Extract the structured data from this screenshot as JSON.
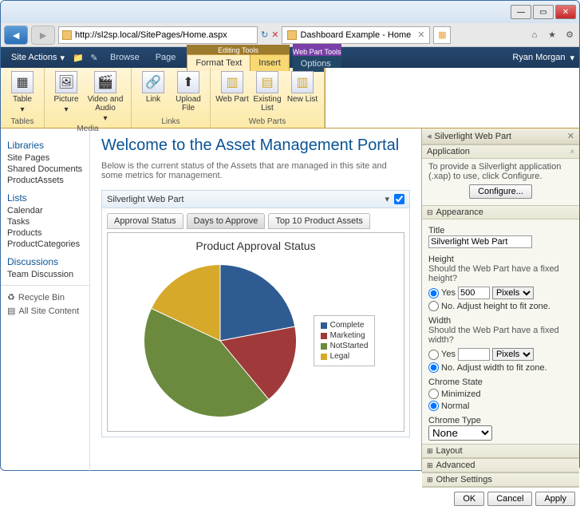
{
  "window": {
    "url": "http://sl2sp.local/SitePages/Home.aspx",
    "tab_title": "Dashboard Example - Home"
  },
  "sp": {
    "site_actions": "Site Actions",
    "browse": "Browse",
    "page": "Page",
    "editing_tools": "Editing Tools",
    "format_text": "Format Text",
    "insert": "Insert",
    "webpart_tools": "Web Part Tools",
    "options": "Options",
    "user": "Ryan Morgan"
  },
  "ribbon": {
    "table": "Table",
    "picture": "Picture",
    "video": "Video and Audio",
    "link": "Link",
    "upload": "Upload File",
    "webpart": "Web Part",
    "existing": "Existing List",
    "newlist": "New List",
    "g_tables": "Tables",
    "g_media": "Media",
    "g_links": "Links",
    "g_webparts": "Web Parts"
  },
  "nav": {
    "libraries": "Libraries",
    "site_pages": "Site Pages",
    "shared_docs": "Shared Documents",
    "product_assets": "ProductAssets",
    "lists": "Lists",
    "calendar": "Calendar",
    "tasks": "Tasks",
    "products": "Products",
    "product_cats": "ProductCategories",
    "discussions": "Discussions",
    "team_disc": "Team Discussion",
    "recycle": "Recycle Bin",
    "all_content": "All Site Content"
  },
  "main": {
    "title": "Welcome to the Asset Management Portal",
    "desc": "Below is the current status of the Assets that are managed in this site and some metrics for management.",
    "wp_title": "Silverlight Web Part",
    "tabs": [
      "Approval Status",
      "Days to Approve",
      "Top 10 Product Assets"
    ],
    "chart_title": "Product Approval Status"
  },
  "chart_data": {
    "type": "pie",
    "title": "Product Approval Status",
    "series": [
      {
        "name": "Complete",
        "value": 22,
        "color": "#2f5b93"
      },
      {
        "name": "Marketing",
        "value": 17,
        "color": "#a03a3a"
      },
      {
        "name": "NotStarted",
        "value": 43,
        "color": "#6b8a3e"
      },
      {
        "name": "Legal",
        "value": 18,
        "color": "#d6a92a"
      }
    ]
  },
  "props": {
    "title": "Silverlight Web Part",
    "sec_app": "Application",
    "app_hint": "To provide a Silverlight application (.xap) to use, click Configure.",
    "configure": "Configure...",
    "sec_appearance": "Appearance",
    "lbl_title": "Title",
    "val_title": "Silverlight Web Part",
    "lbl_height": "Height",
    "height_q": "Should the Web Part have a fixed height?",
    "yes": "Yes",
    "no_height": "No. Adjust height to fit zone.",
    "height_val": "500",
    "pixels": "Pixels",
    "lbl_width": "Width",
    "width_q": "Should the Web Part have a fixed width?",
    "no_width": "No. Adjust width to fit zone.",
    "lbl_chrome_state": "Chrome State",
    "minimized": "Minimized",
    "normal": "Normal",
    "lbl_chrome_type": "Chrome Type",
    "chrome_type": "None",
    "sec_layout": "Layout",
    "sec_advanced": "Advanced",
    "sec_other": "Other Settings",
    "ok": "OK",
    "cancel": "Cancel",
    "apply": "Apply"
  }
}
